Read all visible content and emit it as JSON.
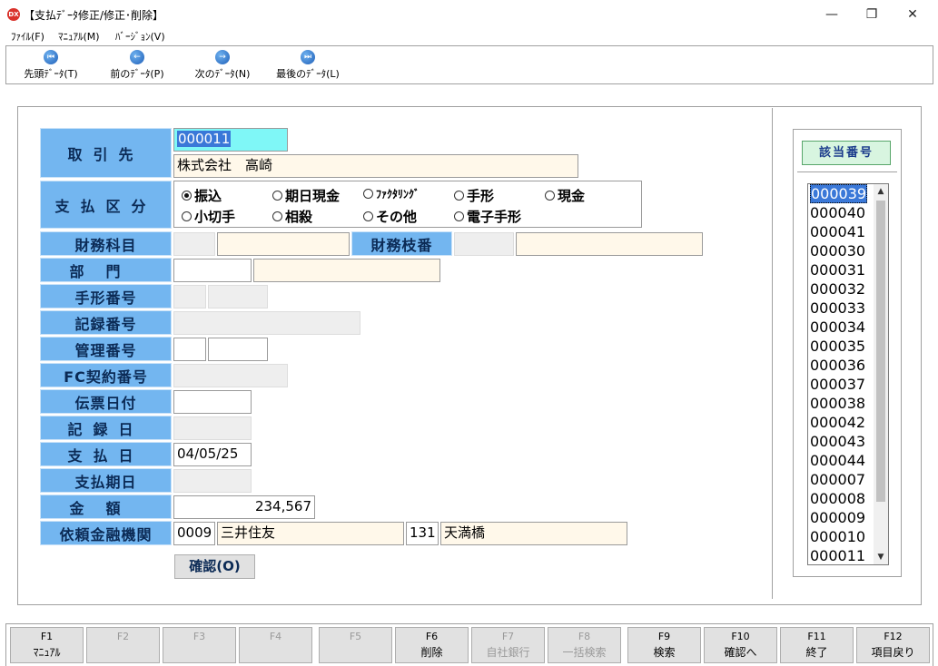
{
  "window": {
    "app_icon": "DX",
    "title": "【支払ﾃﾞｰﾀ修正/修正･削除】",
    "minimize": "—",
    "maximize": "❐",
    "close": "✕"
  },
  "menu": {
    "file": "ﾌｧｲﾙ(F)",
    "manual": "ﾏﾆｭｱﾙ(M)",
    "version": "ﾊﾞｰｼﾞｮﾝ(V)"
  },
  "toolbar": {
    "first": "先頭ﾃﾞｰﾀ(T)",
    "prev": "前のﾃﾞｰﾀ(P)",
    "next": "次のﾃﾞｰﾀ(N)",
    "last": "最後のﾃﾞｰﾀ(L)",
    "first_glyph": "⏮",
    "prev_glyph": "←",
    "next_glyph": "→",
    "last_glyph": "⏭"
  },
  "form": {
    "supplier": {
      "label": "取引先",
      "code": "000011",
      "name": "株式会社　高崎"
    },
    "payment_type": {
      "label": "支払区分",
      "options": [
        "振込",
        "期日現金",
        "ﾌｧｸﾀﾘﾝｸﾞ",
        "手形",
        "現金",
        "小切手",
        "相殺",
        "その他",
        "電子手形"
      ],
      "selected": "振込"
    },
    "account_subject": {
      "label": "財務科目",
      "code": "",
      "name": ""
    },
    "account_branch": {
      "label": "財務枝番",
      "code": "",
      "name": ""
    },
    "department": {
      "label": "部門",
      "code": "",
      "name": ""
    },
    "bill_number": {
      "label": "手形番号",
      "part1": "",
      "part2": ""
    },
    "record_number": {
      "label": "記録番号",
      "value": ""
    },
    "management_number": {
      "label": "管理番号",
      "part1": "",
      "part2": ""
    },
    "fc_contract_number": {
      "label": "FC契約番号",
      "value": ""
    },
    "slip_date": {
      "label": "伝票日付",
      "value": ""
    },
    "record_date": {
      "label": "記録日",
      "value": ""
    },
    "payment_date": {
      "label": "支払日",
      "value": "04/05/25"
    },
    "payment_due_date": {
      "label": "支払期日",
      "value": ""
    },
    "amount": {
      "label": "金額",
      "value": "234,567"
    },
    "bank": {
      "label": "依頼金融機関",
      "bank_code": "0009",
      "bank_name": "三井住友",
      "branch_code": "131",
      "branch_name": "天満橋"
    },
    "confirm_button": "確認(O)"
  },
  "match_panel": {
    "header": "該当番号",
    "items": [
      "000039",
      "000040",
      "000041",
      "000030",
      "000031",
      "000032",
      "000033",
      "000034",
      "000035",
      "000036",
      "000037",
      "000038",
      "000042",
      "000043",
      "000044",
      "000007",
      "000008",
      "000009",
      "000010",
      "000011"
    ],
    "selected": "000039"
  },
  "function_keys": [
    {
      "key": "F1",
      "label": "ﾏﾆｭｱﾙ",
      "enabled": true
    },
    {
      "key": "F2",
      "label": "",
      "enabled": false
    },
    {
      "key": "F3",
      "label": "",
      "enabled": false
    },
    {
      "key": "F4",
      "label": "",
      "enabled": false
    },
    {
      "key": "F5",
      "label": "",
      "enabled": false
    },
    {
      "key": "F6",
      "label": "削除",
      "enabled": true
    },
    {
      "key": "F7",
      "label": "自社銀行",
      "enabled": false
    },
    {
      "key": "F8",
      "label": "一括検索",
      "enabled": false
    },
    {
      "key": "F9",
      "label": "検索",
      "enabled": true
    },
    {
      "key": "F10",
      "label": "確認へ",
      "enabled": true
    },
    {
      "key": "F11",
      "label": "終了",
      "enabled": true
    },
    {
      "key": "F12",
      "label": "項目戻り",
      "enabled": true
    }
  ]
}
